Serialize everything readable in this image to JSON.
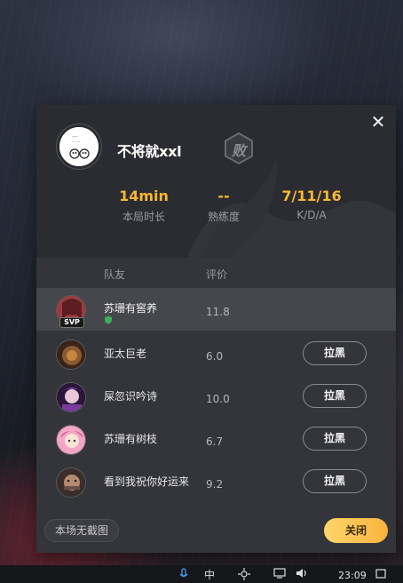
{
  "dialog": {
    "player_name": "不将就xxl",
    "result_badge": "败",
    "close_symbol": "✕",
    "stats": {
      "duration_value": "14min",
      "duration_label": "本局时长",
      "proficiency_value": "--",
      "proficiency_label": "熟练度",
      "kda_value": "7/11/16",
      "kda_label": "K/D/A"
    },
    "columns": {
      "team": "队友",
      "rating": "评价"
    },
    "teammates": [
      {
        "name": "苏珊有窖养",
        "score": "11.8",
        "badge": "SVP",
        "is_self": true,
        "avatar_color": "#a03a3e"
      },
      {
        "name": "亚太巨老",
        "score": "6.0",
        "block_label": "拉黑",
        "avatar_color": "#8a5a34"
      },
      {
        "name": "屎忽识吟诗",
        "score": "10.0",
        "block_label": "拉黑",
        "avatar_color": "#7a3aa0"
      },
      {
        "name": "苏珊有树枝",
        "score": "6.7",
        "block_label": "拉黑",
        "avatar_color": "#d0508a"
      },
      {
        "name": "看到我祝你好运来",
        "score": "9.2",
        "block_label": "拉黑",
        "avatar_color": "#6a5048"
      }
    ],
    "footer": {
      "no_screenshot_label": "本场无截图",
      "close_label": "关闭"
    },
    "colors": {
      "accent_yellow": "#f7b731",
      "close_btn": "#fbc351"
    }
  },
  "taskbar": {
    "ime_label": "中",
    "time": "23:09"
  }
}
